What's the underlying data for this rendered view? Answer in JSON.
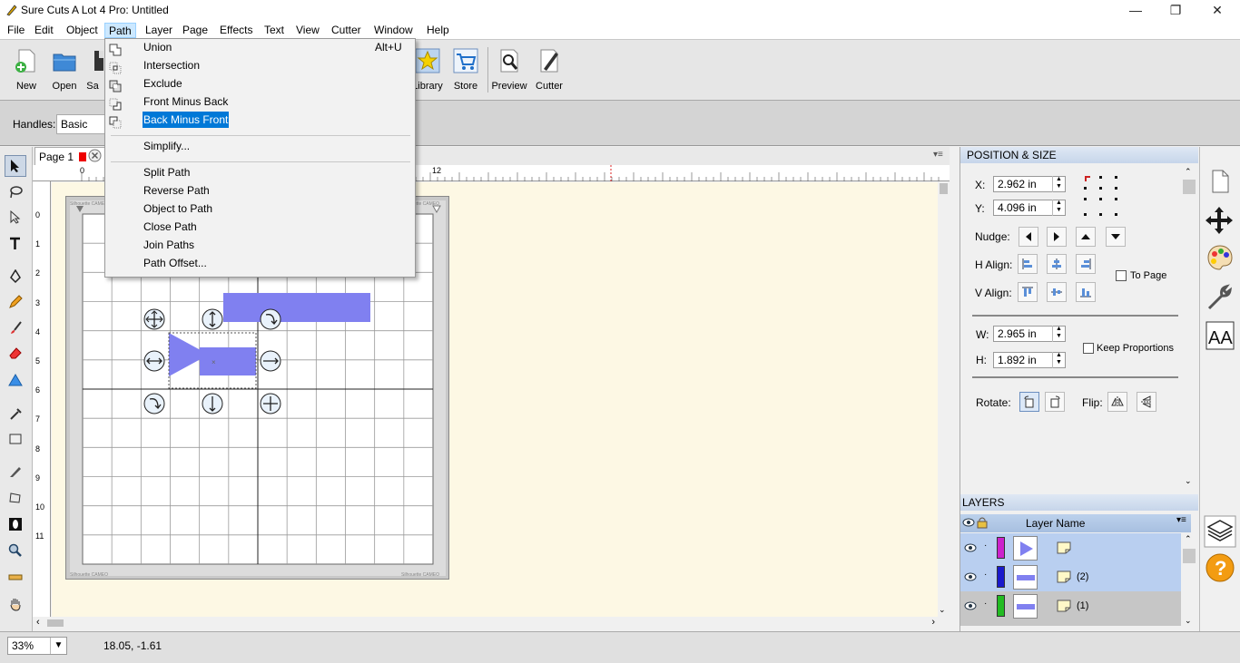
{
  "window": {
    "title": "Sure Cuts A Lot 4 Pro: Untitled",
    "min": "—",
    "max": "❐",
    "close": "✕"
  },
  "menubar": [
    "File",
    "Edit",
    "Object",
    "Path",
    "Layer",
    "Page",
    "Effects",
    "Text",
    "View",
    "Cutter",
    "Window",
    "Help"
  ],
  "toolbar": {
    "new": "New",
    "open": "Open",
    "save": "Sa",
    "library": "Library",
    "store": "Store",
    "preview": "Preview",
    "cutter": "Cutter"
  },
  "handles": {
    "label": "Handles:",
    "value": "Basic"
  },
  "path_menu": {
    "union": "Union",
    "union_shortcut": "Alt+U",
    "intersection": "Intersection",
    "exclude": "Exclude",
    "front_minus_back": "Front Minus Back",
    "back_minus_front": "Back Minus Front",
    "simplify": "Simplify...",
    "split_path": "Split Path",
    "reverse_path": "Reverse Path",
    "object_to_path": "Object to Path",
    "close_path": "Close Path",
    "join_paths": "Join Paths",
    "path_offset": "Path Offset..."
  },
  "canvas": {
    "tab": "Page 1",
    "ruler_top": [
      "0",
      "12"
    ],
    "ruler_left": [
      "0",
      "1",
      "2",
      "3",
      "4",
      "5",
      "6",
      "7",
      "8",
      "9",
      "10",
      "11"
    ],
    "mat_brand": "Silhouette CAMEO"
  },
  "status": {
    "zoom": "33%",
    "coords": "18.05, -1.61"
  },
  "position_size": {
    "header": "POSITION & SIZE",
    "x_label": "X:",
    "x": "2.962 in",
    "y_label": "Y:",
    "y": "4.096 in",
    "nudge": "Nudge:",
    "h_align": "H Align:",
    "v_align": "V Align:",
    "to_page": "To Page",
    "w_label": "W:",
    "w": "2.965 in",
    "h_label": "H:",
    "h": "1.892 in",
    "keep_proportions": "Keep Proportions",
    "rotate": "Rotate:",
    "flip": "Flip:"
  },
  "layers": {
    "header": "LAYERS",
    "col_name": "Layer Name",
    "rows": [
      {
        "name": "",
        "color": "#cc22cc"
      },
      {
        "name": "(2)",
        "color": "#1a1acc"
      },
      {
        "name": "(1)",
        "color": "#22bb22"
      }
    ]
  },
  "colors": {
    "shape": "#8080f0",
    "canvas_bg": "#fdf8e4",
    "highlight": "#0078d7"
  }
}
